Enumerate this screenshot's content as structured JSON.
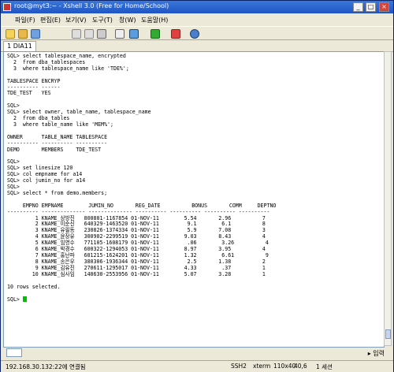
{
  "window": {
    "title": "root@myt3:~ - Xshell 3.0 (Free for Home/School)",
    "minimize": "_",
    "maximize": "□",
    "close": "×"
  },
  "menu": [
    "파일(F)",
    "편집(E)",
    "보기(V)",
    "도구(T)",
    "창(W)",
    "도움말(H)"
  ],
  "tabs": [
    {
      "label": "1 DIA11"
    }
  ],
  "terminal_lines": [
    "SQL> select tablespace_name, encrypted",
    "  2  from dba_tablespaces",
    "  3  where tablespace_name like 'TDE%';",
    "",
    "TABLESPACE ENCRYP",
    "---------- ------",
    "TDE_TEST   YES",
    "",
    "SQL>",
    "SQL> select owner, table_name, tablespace_name",
    "  2  from dba_tables",
    "  3  where table_name like 'MEM%';",
    "",
    "OWNER      TABLE_NAME TABLESPACE",
    "---------- ---------- ----------",
    "DEMO       MEMBERS    TDE_TEST",
    "",
    "SQL>",
    "SQL> set linesize 120",
    "SQL> col empname for a14",
    "SQL> col jumin_no for a14",
    "SQL>",
    "SQL> select * from demo.members;",
    "",
    "     EMPNO EMPNAME        JUMIN_NO       REG_DATE          BONUS       COMM     DEPTNO",
    "---------- -------------- -------------- ---------- ---------- ---------- ----------",
    "         1 KNAME_상방진   800801-1167854 01-NOV-11        5.54       2.96          7",
    "         2 KNAME_이순신   640329-1463520 01-NOV-11         9.1        6.1          8",
    "         3 KNAME_유필동   230826-1374334 01-NOV-11         5.9       7.08          3",
    "         4 KNAME_윤장유   300902-2299519 01-NOV-11        9.03       8.43          4",
    "         5 KNAME_임영수   771105-1608179 01-NOV-11         .06        3.26          4",
    "         6 KNAME_박경수   600322-1294053 01-NOV-11        8.97       3.95          4",
    "         7 KNAME_홍난파   601215-1624201 01-NOV-11        1.32        6.61          9",
    "         8 KNAME_송은우   380306-1936344 01-NOV-11         2.5       1.38          2",
    "         9 KNAME_김유진   270611-1295017 01-NOV-11        4.33        .37          1",
    "        10 KNAME_심사임   140630-2553956 01-NOV-11        5.07       3.28          1",
    "",
    "10 rows selected.",
    "",
    "SQL> "
  ],
  "input_bar": {
    "label": "▸ 입력"
  },
  "status": {
    "host": "192.168.30.132:22에 연결됨",
    "protocol": "SSH2",
    "term": "xterm",
    "size": "110x40",
    "cursor": "40,6",
    "sessions": "1 세션"
  },
  "colors": {
    "titlebar": "#2458c8",
    "cursor": "#00c000"
  },
  "icons": [
    "new-session-icon",
    "open-icon",
    "properties-icon",
    "copy-icon",
    "paste-icon",
    "find-icon",
    "print-icon",
    "transfer-icon",
    "script-icon",
    "help-icon"
  ]
}
